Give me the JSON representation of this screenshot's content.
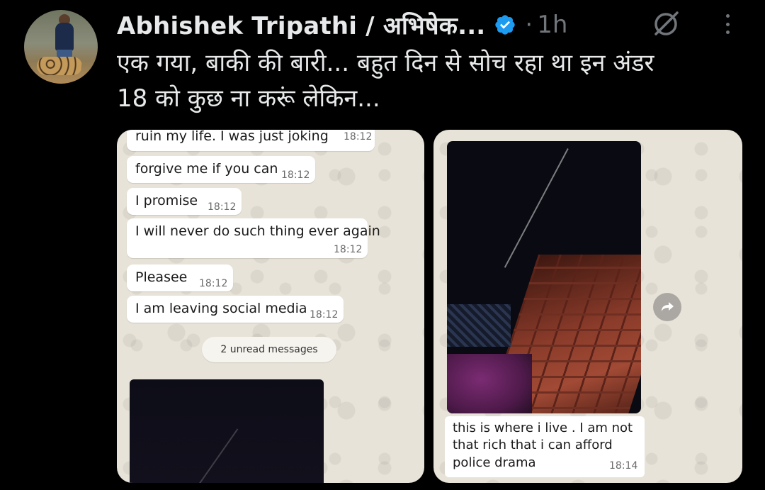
{
  "tweet": {
    "author_name": "Abhishek Tripathi / अभिषेक...",
    "separator": "·",
    "time": "1h",
    "text_line1": "एक गया, बाकी की बारी... बहुत दिन से सोच रहा था इन अंडर",
    "text_line2": "18 को कुछ ना करूं लेकिन..."
  },
  "icons": {
    "verified": "verified-badge-icon",
    "grok": "grok-icon",
    "more": "more-options-icon",
    "forward": "forward-icon"
  },
  "colors": {
    "background": "#000000",
    "text": "#e7e9ea",
    "muted": "#71767b",
    "verified": "#1d9bf0",
    "chat_bg": "#e8e3d8"
  },
  "media1": {
    "messages": [
      {
        "text": "ruin my life. I was just joking",
        "time": "18:12"
      },
      {
        "text": "forgive me if you can",
        "time": "18:12"
      },
      {
        "text": "I promise",
        "time": "18:12"
      },
      {
        "text": "I will never do such thing ever again",
        "time": "18:12"
      },
      {
        "text": "Pleasee",
        "time": "18:12"
      },
      {
        "text": "I am leaving social media",
        "time": "18:12"
      }
    ],
    "unread_label": "2 unread messages"
  },
  "media2": {
    "caption_line1": "this is where i live . I am not",
    "caption_line2": "that rich that i can afford",
    "caption_line3": "police drama",
    "time": "18:14"
  }
}
